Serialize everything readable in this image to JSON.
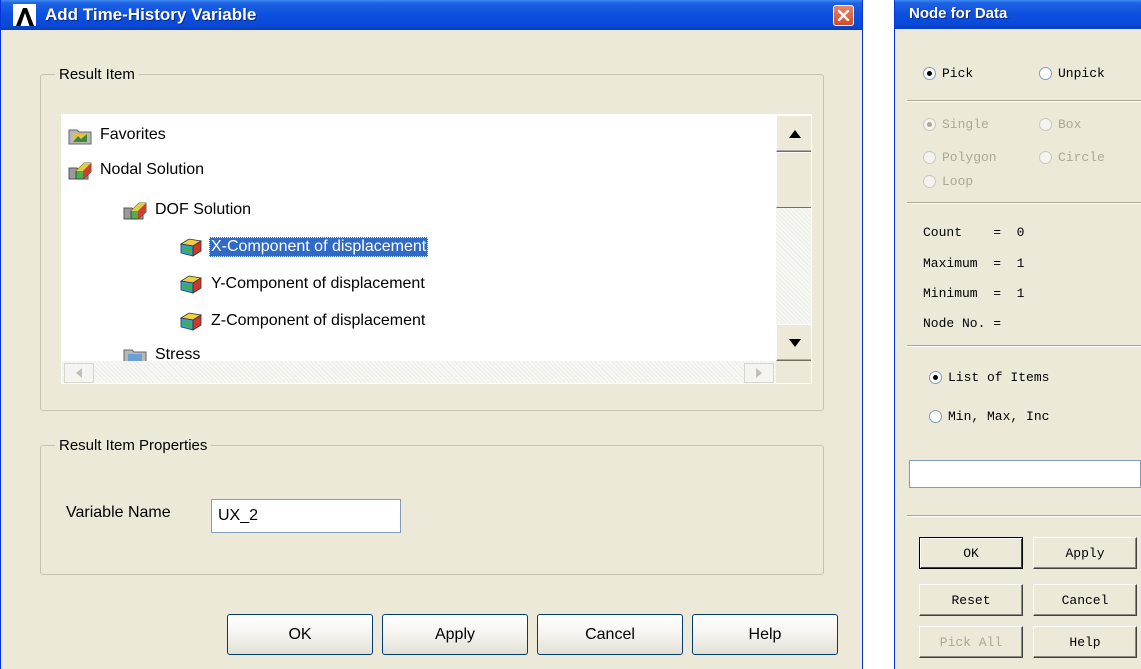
{
  "left_dialog": {
    "title": "Add Time-History Variable",
    "result_item": {
      "legend": "Result Item",
      "tree": [
        {
          "label": "Favorites",
          "icon": "folder-favorites-icon"
        },
        {
          "label": "Nodal Solution",
          "icon": "nodal-folder-icon"
        },
        {
          "label": "DOF Solution",
          "icon": "nodal-folder-icon"
        },
        {
          "label": "X-Component of displacement",
          "icon": "cube-result-icon",
          "selected": true
        },
        {
          "label": "Y-Component of displacement",
          "icon": "cube-result-icon"
        },
        {
          "label": "Z-Component of displacement",
          "icon": "cube-result-icon"
        },
        {
          "label": "Stress",
          "icon": "folder-icon"
        }
      ]
    },
    "properties": {
      "legend": "Result Item Properties",
      "variable_name_label": "Variable Name",
      "variable_name_value": "UX_2"
    },
    "buttons": {
      "ok": "OK",
      "apply": "Apply",
      "cancel": "Cancel",
      "help": "Help"
    }
  },
  "right_dialog": {
    "title": "Node for Data",
    "mode": {
      "pick": "Pick",
      "unpick": "Unpick"
    },
    "shape": {
      "single": "Single",
      "box": "Box",
      "polygon": "Polygon",
      "circle": "Circle",
      "loop": "Loop"
    },
    "stats": {
      "count": "Count    =  0",
      "maximum": "Maximum  =  1",
      "minimum": "Minimum  =  1",
      "node_no": "Node No. ="
    },
    "entry": {
      "list": "List of Items",
      "range": "Min, Max, Inc"
    },
    "buttons": {
      "ok": "OK",
      "apply": "Apply",
      "reset": "Reset",
      "cancel": "Cancel",
      "pick_all": "Pick All",
      "help": "Help"
    }
  },
  "colors": {
    "title_bar": "#0a49d6",
    "selection": "#316ac5",
    "dialog_bg": "#ece9d8"
  }
}
